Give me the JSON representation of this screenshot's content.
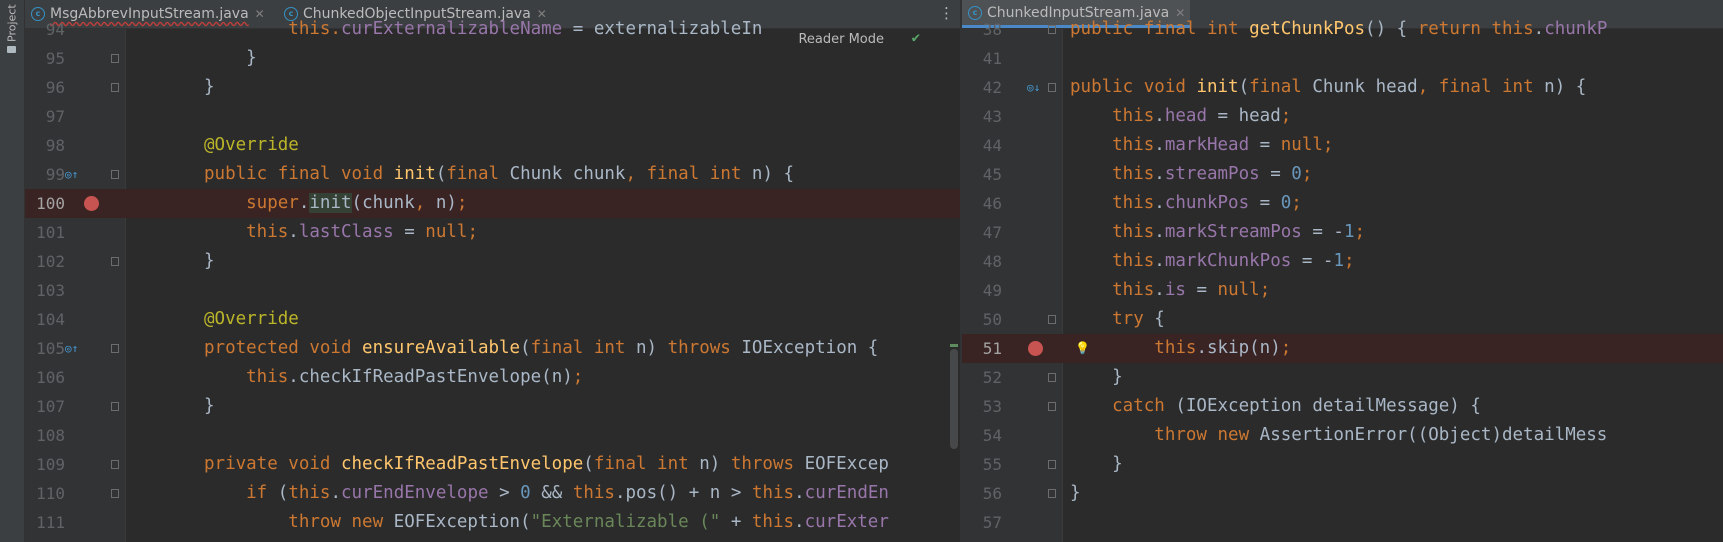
{
  "sidebar": {
    "project_label": "Project"
  },
  "left": {
    "tabs": [
      {
        "name": "MsgAbbrevInputStream.java",
        "active": false,
        "error": true
      },
      {
        "name": "ChunkedObjectInputStream.java",
        "active": false,
        "error": false
      }
    ],
    "reader_mode": "Reader Mode",
    "lines": [
      {
        "n": "94",
        "tokens": [
          [
            "        this.",
            "k"
          ],
          [
            "curExternalizableName",
            "fld"
          ],
          [
            " = externalizableIn",
            ""
          ]
        ]
      },
      {
        "n": "95",
        "tokens": [
          [
            "    }",
            ""
          ]
        ]
      },
      {
        "n": "96",
        "tokens": [
          [
            "}",
            ""
          ]
        ]
      },
      {
        "n": "97",
        "tokens": []
      },
      {
        "n": "98",
        "tokens": [
          [
            "@Override",
            "ann"
          ]
        ]
      },
      {
        "n": "99",
        "tokens": [
          [
            "public final void ",
            "k"
          ],
          [
            "init",
            "f"
          ],
          [
            "(",
            ""
          ],
          [
            "final ",
            "k"
          ],
          [
            "Chunk chunk",
            ""
          ],
          [
            ", ",
            "k"
          ],
          [
            "final int ",
            "k"
          ],
          [
            "n) {",
            ""
          ]
        ]
      },
      {
        "n": "100",
        "tokens": [
          [
            "    super",
            "k"
          ],
          [
            ".",
            ""
          ],
          [
            "init",
            "hl"
          ],
          [
            "(chunk",
            ""
          ],
          [
            ", ",
            "k"
          ],
          [
            "n)",
            ""
          ],
          [
            ";",
            "k"
          ]
        ]
      },
      {
        "n": "101",
        "tokens": [
          [
            "    this",
            "k"
          ],
          [
            ".",
            ""
          ],
          [
            "lastClass",
            "fld"
          ],
          [
            " = ",
            ""
          ],
          [
            "null",
            "k"
          ],
          [
            ";",
            "k"
          ]
        ]
      },
      {
        "n": "102",
        "tokens": [
          [
            "}",
            ""
          ]
        ]
      },
      {
        "n": "103",
        "tokens": []
      },
      {
        "n": "104",
        "tokens": [
          [
            "@Override",
            "ann"
          ]
        ]
      },
      {
        "n": "105",
        "tokens": [
          [
            "protected void ",
            "k"
          ],
          [
            "ensureAvailable",
            "f"
          ],
          [
            "(",
            ""
          ],
          [
            "final int ",
            "k"
          ],
          [
            "n) ",
            ""
          ],
          [
            "throws ",
            "k"
          ],
          [
            "IOException {",
            ""
          ]
        ]
      },
      {
        "n": "106",
        "tokens": [
          [
            "    this",
            "k"
          ],
          [
            ".checkIfReadPastEnvelope(n)",
            ""
          ],
          [
            ";",
            "k"
          ]
        ]
      },
      {
        "n": "107",
        "tokens": [
          [
            "}",
            ""
          ]
        ]
      },
      {
        "n": "108",
        "tokens": []
      },
      {
        "n": "109",
        "tokens": [
          [
            "private void ",
            "k"
          ],
          [
            "checkIfReadPastEnvelope",
            "f"
          ],
          [
            "(",
            ""
          ],
          [
            "final int ",
            "k"
          ],
          [
            "n) ",
            ""
          ],
          [
            "throws ",
            "k"
          ],
          [
            "EOFExcep",
            ""
          ]
        ]
      },
      {
        "n": "110",
        "tokens": [
          [
            "    if ",
            "k"
          ],
          [
            "(",
            ""
          ],
          [
            "this",
            "k"
          ],
          [
            ".",
            ""
          ],
          [
            "curEndEnvelope",
            "fld"
          ],
          [
            " > ",
            ""
          ],
          [
            "0 ",
            "num"
          ],
          [
            "&& ",
            ""
          ],
          [
            "this",
            "k"
          ],
          [
            ".pos() + n > ",
            ""
          ],
          [
            "this",
            "k"
          ],
          [
            ".",
            ""
          ],
          [
            "curEndEn",
            "fld"
          ]
        ]
      },
      {
        "n": "111",
        "tokens": [
          [
            "        throw new ",
            "k"
          ],
          [
            "EOFException(",
            ""
          ],
          [
            "\"Externalizable (\"",
            "str"
          ],
          [
            " + ",
            ""
          ],
          [
            "this",
            "k"
          ],
          [
            ".",
            ""
          ],
          [
            "curExter",
            "fld"
          ]
        ]
      }
    ]
  },
  "right": {
    "tabs": [
      {
        "name": "ChunkedInputStream.java",
        "active": true,
        "error": false
      }
    ],
    "lines": [
      {
        "n": "38",
        "tokens": [
          [
            "public final int ",
            "k"
          ],
          [
            "getChunkPos",
            "f"
          ],
          [
            "() ",
            ""
          ],
          [
            "{ ",
            ""
          ],
          [
            "return ",
            "k"
          ],
          [
            "this",
            "k"
          ],
          [
            ".",
            ""
          ],
          [
            "chunkP",
            "fld"
          ]
        ]
      },
      {
        "n": "41",
        "tokens": []
      },
      {
        "n": "42",
        "tokens": [
          [
            "public void ",
            "k"
          ],
          [
            "init",
            "f"
          ],
          [
            "(",
            ""
          ],
          [
            "final ",
            "k"
          ],
          [
            "Chunk head",
            ""
          ],
          [
            ", ",
            "k"
          ],
          [
            "final int ",
            "k"
          ],
          [
            "n) {",
            ""
          ]
        ]
      },
      {
        "n": "43",
        "tokens": [
          [
            "    this",
            "k"
          ],
          [
            ".",
            ""
          ],
          [
            "head",
            "fld"
          ],
          [
            " = head",
            ""
          ],
          [
            ";",
            "k"
          ]
        ]
      },
      {
        "n": "44",
        "tokens": [
          [
            "    this",
            "k"
          ],
          [
            ".",
            ""
          ],
          [
            "markHead",
            "fld"
          ],
          [
            " = ",
            ""
          ],
          [
            "null",
            "k"
          ],
          [
            ";",
            "k"
          ]
        ]
      },
      {
        "n": "45",
        "tokens": [
          [
            "    this",
            "k"
          ],
          [
            ".",
            ""
          ],
          [
            "streamPos",
            "fld"
          ],
          [
            " = ",
            ""
          ],
          [
            "0",
            "num"
          ],
          [
            ";",
            "k"
          ]
        ]
      },
      {
        "n": "46",
        "tokens": [
          [
            "    this",
            "k"
          ],
          [
            ".",
            ""
          ],
          [
            "chunkPos",
            "fld"
          ],
          [
            " = ",
            ""
          ],
          [
            "0",
            "num"
          ],
          [
            ";",
            "k"
          ]
        ]
      },
      {
        "n": "47",
        "tokens": [
          [
            "    this",
            "k"
          ],
          [
            ".",
            ""
          ],
          [
            "markStreamPos",
            "fld"
          ],
          [
            " = -",
            ""
          ],
          [
            "1",
            "num"
          ],
          [
            ";",
            "k"
          ]
        ]
      },
      {
        "n": "48",
        "tokens": [
          [
            "    this",
            "k"
          ],
          [
            ".",
            ""
          ],
          [
            "markChunkPos",
            "fld"
          ],
          [
            " = -",
            ""
          ],
          [
            "1",
            "num"
          ],
          [
            ";",
            "k"
          ]
        ]
      },
      {
        "n": "49",
        "tokens": [
          [
            "    this",
            "k"
          ],
          [
            ".",
            ""
          ],
          [
            "is",
            "fld"
          ],
          [
            " = ",
            ""
          ],
          [
            "null",
            "k"
          ],
          [
            ";",
            "k"
          ]
        ]
      },
      {
        "n": "50",
        "tokens": [
          [
            "    try ",
            "k"
          ],
          [
            "{",
            ""
          ]
        ]
      },
      {
        "n": "51",
        "tokens": [
          [
            "        this",
            "k"
          ],
          [
            ".skip(n)",
            ""
          ],
          [
            ";",
            "k"
          ]
        ]
      },
      {
        "n": "52",
        "tokens": [
          [
            "    }",
            ""
          ]
        ]
      },
      {
        "n": "53",
        "tokens": [
          [
            "    catch ",
            "k"
          ],
          [
            "(IOException detailMessage) {",
            ""
          ]
        ]
      },
      {
        "n": "54",
        "tokens": [
          [
            "        throw new ",
            "k"
          ],
          [
            "AssertionError((Object)detailMess",
            ""
          ]
        ]
      },
      {
        "n": "55",
        "tokens": [
          [
            "    }",
            ""
          ]
        ]
      },
      {
        "n": "56",
        "tokens": [
          [
            "}",
            ""
          ]
        ]
      },
      {
        "n": "57",
        "tokens": []
      }
    ]
  },
  "colors": {
    "keyword": "#cc7832",
    "function": "#ffc66d",
    "field": "#9876aa",
    "annotation": "#bbb529",
    "number": "#6897bb",
    "string": "#6a8759",
    "breakpoint": "#c75450",
    "breakpoint_line": "#3a2323"
  },
  "icons": [
    "breakpoint-icon",
    "override-up-icon",
    "fold-icon",
    "bulb-icon",
    "check-icon",
    "more-vertical-icon",
    "close-icon",
    "class-c-icon",
    "folder-icon"
  ]
}
